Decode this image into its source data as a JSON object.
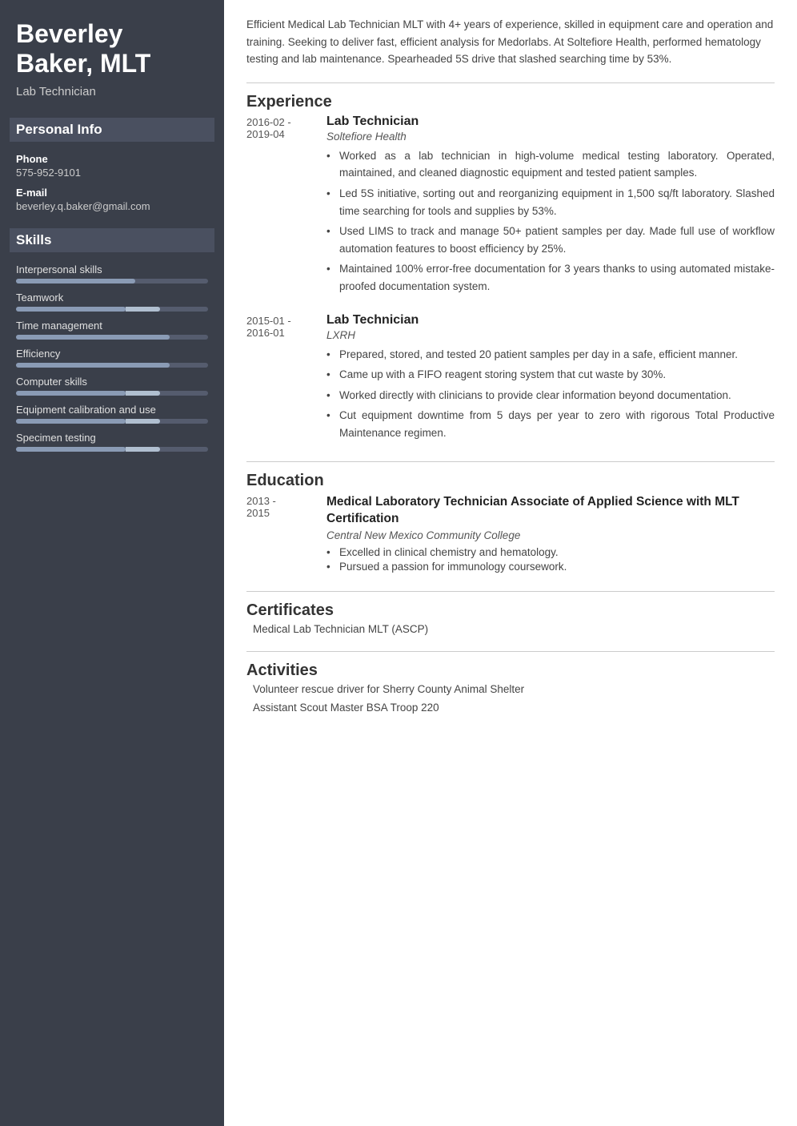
{
  "sidebar": {
    "name": "Beverley Baker, MLT",
    "name_line1": "Beverley",
    "name_line2": "Baker, MLT",
    "title": "Lab Technician",
    "personal_info_heading": "Personal Info",
    "phone_label": "Phone",
    "phone_value": "575-952-9101",
    "email_label": "E-mail",
    "email_value": "beverley.q.baker@gmail.com",
    "skills_heading": "Skills",
    "skills": [
      {
        "name": "Interpersonal skills",
        "filled_pct": 62,
        "accent_pct": 0
      },
      {
        "name": "Teamwork",
        "filled_pct": 57,
        "accent_pct": 18
      },
      {
        "name": "Time management",
        "filled_pct": 80,
        "accent_pct": 0
      },
      {
        "name": "Efficiency",
        "filled_pct": 80,
        "accent_pct": 0
      },
      {
        "name": "Computer skills",
        "filled_pct": 57,
        "accent_pct": 18
      },
      {
        "name": "Equipment calibration and use",
        "filled_pct": 57,
        "accent_pct": 18
      },
      {
        "name": "Specimen testing",
        "filled_pct": 57,
        "accent_pct": 18
      }
    ]
  },
  "main": {
    "summary": "Efficient Medical Lab Technician MLT with 4+ years of experience, skilled in equipment care and operation and training. Seeking to deliver fast, efficient analysis for Medorlabs. At Soltefiore Health, performed hematology testing and lab maintenance. Spearheaded 5S drive that slashed searching time by 53%.",
    "experience_heading": "Experience",
    "jobs": [
      {
        "dates": "2016-02 -\n2019-04",
        "title": "Lab Technician",
        "company": "Soltefiore Health",
        "bullets": [
          "Worked as a lab technician in high-volume medical testing laboratory. Operated, maintained, and cleaned diagnostic equipment and tested patient samples.",
          "Led 5S initiative, sorting out and reorganizing equipment in 1,500 sq/ft laboratory. Slashed time searching for tools and supplies by 53%.",
          "Used LIMS to track and manage 50+ patient samples per day. Made full use of workflow automation features to boost efficiency by 25%.",
          "Maintained 100% error-free documentation for 3 years thanks to using automated mistake-proofed documentation system."
        ]
      },
      {
        "dates": "2015-01 -\n2016-01",
        "title": "Lab Technician",
        "company": "LXRH",
        "bullets": [
          "Prepared, stored, and tested 20 patient samples per day in a safe, efficient manner.",
          "Came up with a FIFO reagent storing system that cut waste by 30%.",
          "Worked directly with clinicians to provide clear information beyond documentation.",
          "Cut equipment downtime from 5 days per year to zero with rigorous Total Productive Maintenance regimen."
        ]
      }
    ],
    "education_heading": "Education",
    "education": [
      {
        "dates": "2013 -\n2015",
        "degree": "Medical Laboratory Technician Associate of Applied Science with MLT Certification",
        "school": "Central New Mexico Community College",
        "bullets": [
          "Excelled in clinical chemistry and hematology.",
          "Pursued a passion for immunology coursework."
        ]
      }
    ],
    "certificates_heading": "Certificates",
    "certificates": [
      "Medical Lab Technician MLT (ASCP)"
    ],
    "activities_heading": "Activities",
    "activities": [
      "Volunteer rescue driver for Sherry County Animal Shelter",
      "Assistant Scout Master BSA Troop 220"
    ]
  }
}
